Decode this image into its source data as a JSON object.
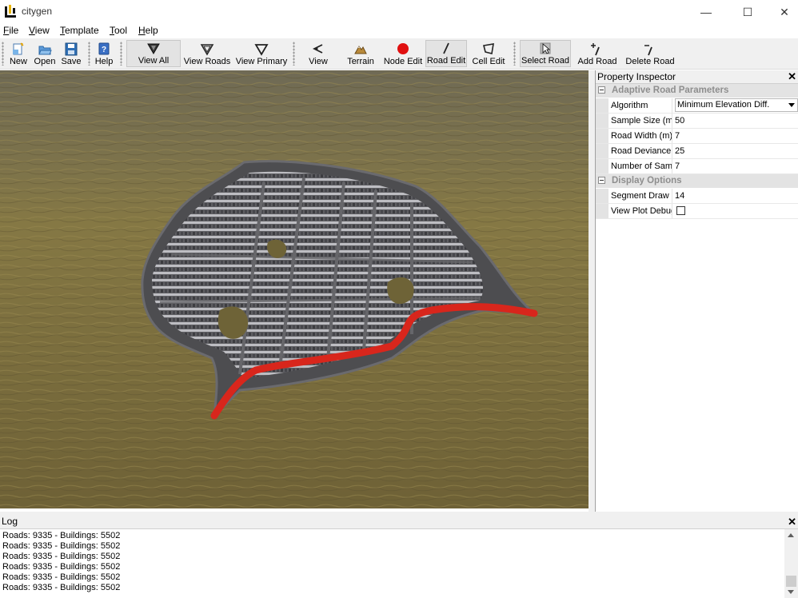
{
  "window": {
    "title": "citygen",
    "minimize_glyph": "—",
    "maximize_glyph": "☐",
    "close_glyph": "✕"
  },
  "menu": [
    {
      "mnemonic": "F",
      "rest": "ile"
    },
    {
      "mnemonic": "V",
      "rest": "iew"
    },
    {
      "mnemonic": "T",
      "rest": "emplate"
    },
    {
      "mnemonic": "T",
      "rest": "ool"
    },
    {
      "mnemonic": "H",
      "rest": "elp"
    }
  ],
  "toolbar": {
    "new": "New",
    "open": "Open",
    "save": "Save",
    "help": "Help",
    "view_all": "View All",
    "view_roads": "View Roads",
    "view_primary": "View Primary",
    "view": "View",
    "terrain": "Terrain",
    "node_edit": "Node Edit",
    "road_edit": "Road Edit",
    "cell_edit": "Cell Edit",
    "select_road": "Select Road",
    "add_road": "Add Road",
    "delete_road": "Delete Road"
  },
  "inspector": {
    "title": "Property Inspector",
    "close_glyph": "✕",
    "categories": [
      {
        "title": "Adaptive Road Parameters",
        "rows": [
          {
            "name": "Algorithm",
            "value": "Minimum Elevation Diff."
          },
          {
            "name": "Sample Size (m)",
            "value": "50"
          },
          {
            "name": "Road Width (m)",
            "value": "7"
          },
          {
            "name": "Road Deviance",
            "value": "25"
          },
          {
            "name": "Number of Samples",
            "value": "7"
          }
        ]
      },
      {
        "title": "Display Options",
        "rows": [
          {
            "name": "Segment Draw Size",
            "value": "14"
          },
          {
            "name": "View Plot Debug",
            "value": ""
          }
        ]
      }
    ]
  },
  "log": {
    "title": "Log",
    "close_glyph": "✕",
    "lines": [
      "Roads: 9335 - Buildings: 5502",
      "Roads: 9335 - Buildings: 5502",
      "Roads: 9335 - Buildings: 5502",
      "Roads: 9335 - Buildings: 5502",
      "Roads: 9335 - Buildings: 5502",
      "Roads: 9335 - Buildings: 5502"
    ]
  },
  "colors": {
    "selected_road": "#d8261c",
    "road": "#5a5a5c",
    "terrain": "#7a6a3a",
    "building": "#6e6e72"
  }
}
